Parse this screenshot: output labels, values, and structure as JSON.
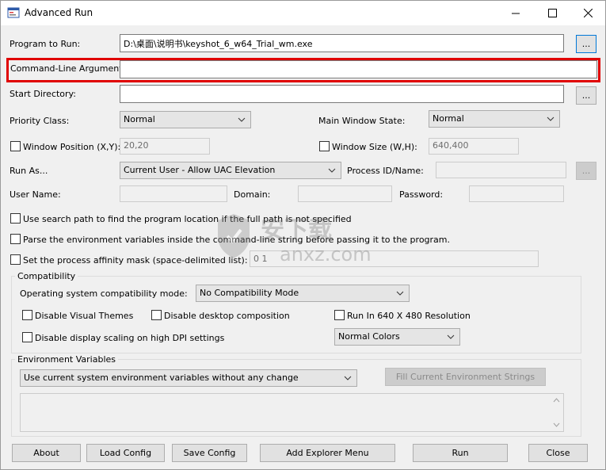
{
  "window": {
    "title": "Advanced Run",
    "icon": "app-window-icon",
    "controls": {
      "minimize": "minimize-icon",
      "maximize": "maximize-icon",
      "close": "close-icon"
    }
  },
  "form": {
    "program_label": "Program to Run:",
    "program_value": "D:\\桌面\\说明书\\keyshot_6_w64_Trial_wm.exe",
    "browse_label": "...",
    "args_label": "Command-Line Arguments:",
    "args_value": "",
    "start_dir_label": "Start Directory:",
    "start_dir_value": "",
    "priority_label": "Priority Class:",
    "priority_value": "Normal",
    "main_window_state_label": "Main Window State:",
    "main_window_state_value": "Normal",
    "window_pos_label": "Window Position (X,Y):",
    "window_pos_value": "20,20",
    "window_size_label": "Window Size (W,H):",
    "window_size_value": "640,400",
    "run_as_label": "Run As...",
    "run_as_value": "Current User - Allow UAC Elevation",
    "process_id_label": "Process ID/Name:",
    "process_id_value": "",
    "username_label": "User Name:",
    "domain_label": "Domain:",
    "password_label": "Password:",
    "search_path_label": "Use search path to find the program location if the full path is not specified",
    "parse_env_label": "Parse the environment variables inside the command-line string before passing it to the program.",
    "affinity_label": "Set the process affinity mask (space-delimited list):",
    "affinity_value": "0 1"
  },
  "compat": {
    "title": "Compatibility",
    "mode_label": "Operating system compatibility mode:",
    "mode_value": "No Compatibility Mode",
    "disable_themes": "Disable Visual Themes",
    "disable_desktop": "Disable desktop composition",
    "run_640": "Run In 640 X 480 Resolution",
    "disable_dpi": "Disable display scaling on high DPI settings",
    "colors_value": "Normal Colors"
  },
  "env": {
    "title": "Environment Variables",
    "mode_value": "Use current system environment variables without any change",
    "fill_button": "Fill Current Environment Strings"
  },
  "buttons": {
    "about": "About",
    "load": "Load Config",
    "save": "Save Config",
    "explorer": "Add Explorer Menu",
    "run": "Run",
    "close": "Close"
  },
  "watermark": {
    "cn": "安下载",
    "domain": "anxz.com"
  },
  "colors": {
    "highlight": "#e00000",
    "focus": "#0078d7"
  }
}
